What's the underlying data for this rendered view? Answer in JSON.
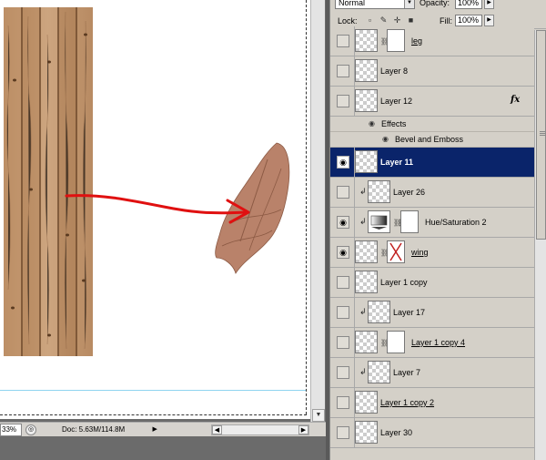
{
  "status_bar": {
    "zoom": "33%",
    "doc_info": "Doc: 5.63M/114.8M",
    "info_icon": "info-circle-icon",
    "menu_icon": "triangle-right-icon"
  },
  "layers_panel": {
    "blend_mode": "Normal",
    "opacity_label": "Opacity:",
    "opacity_value": "100%",
    "lock_label": "Lock:",
    "lock_icons": [
      "lock-transparent-icon",
      "lock-image-icon",
      "lock-position-icon",
      "lock-all-icon"
    ],
    "fill_label": "Fill:",
    "fill_value": "100%",
    "selected_color": "#0a246a",
    "layers": [
      {
        "name": "leg",
        "visible": false,
        "underlined": true,
        "has_mask": true
      },
      {
        "name": "Layer 8",
        "visible": false
      },
      {
        "name": "Layer 12",
        "visible": false,
        "fx": "fx"
      },
      {
        "name": "Layer 11",
        "visible": true,
        "selected": true
      },
      {
        "name": "Layer 26",
        "visible": false,
        "clipped": true
      },
      {
        "name": "Hue/Saturation 2",
        "visible": true,
        "adjustment": true,
        "has_mask": true
      },
      {
        "name": "wing",
        "visible": true,
        "underlined": true,
        "has_mask": true
      },
      {
        "name": "Layer 1 copy",
        "visible": false
      },
      {
        "name": "Layer 17",
        "visible": false,
        "clipped": true
      },
      {
        "name": "Layer 1 copy 4",
        "visible": false,
        "underlined": true,
        "has_mask": true
      },
      {
        "name": "Layer 7",
        "visible": false,
        "clipped": true
      },
      {
        "name": "Layer 1 copy 2",
        "visible": false,
        "underlined": true
      },
      {
        "name": "Layer 30",
        "visible": false
      }
    ],
    "effects": {
      "label": "Effects",
      "items": [
        "Bevel and Emboss"
      ]
    }
  },
  "annotation": {
    "arrow_color": "#e01010"
  }
}
